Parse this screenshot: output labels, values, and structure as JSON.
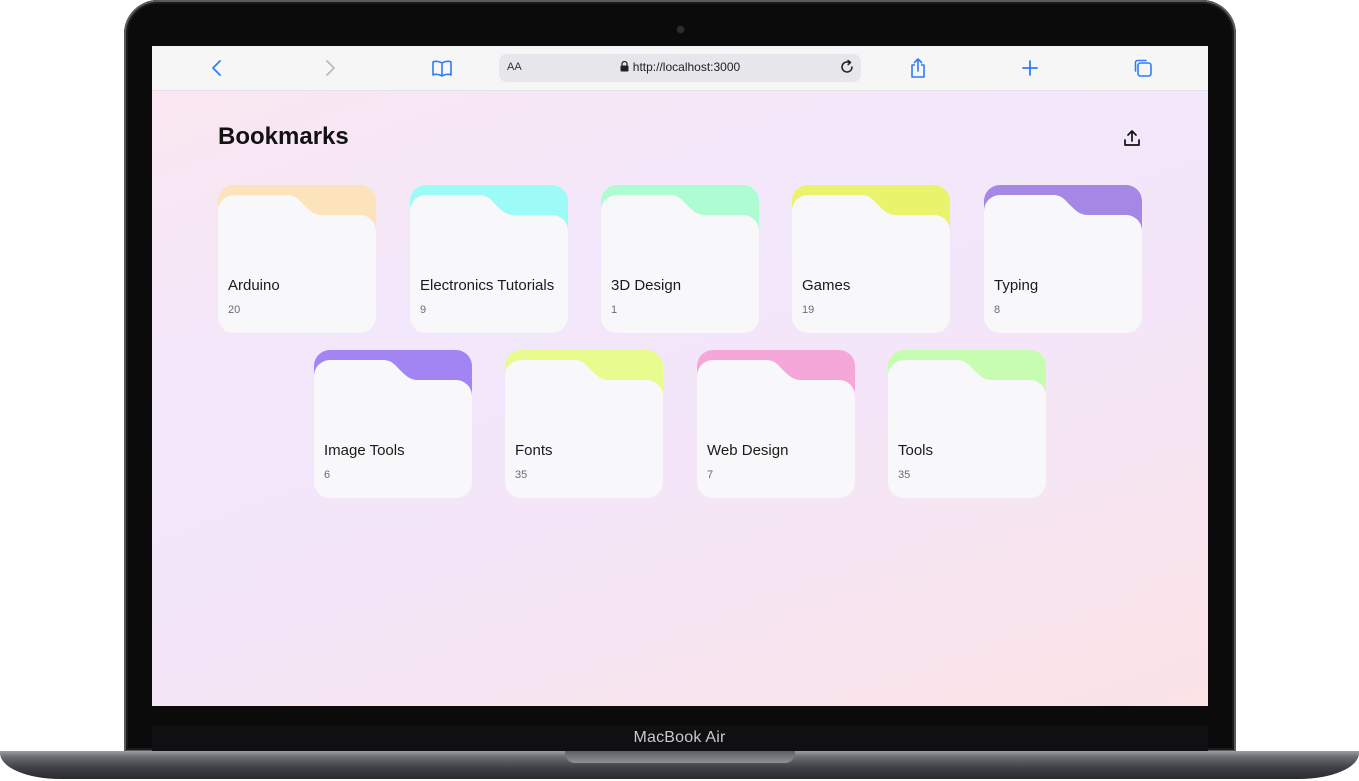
{
  "device": {
    "label": "MacBook Air"
  },
  "browser": {
    "text_size_label": "AA",
    "url": "http://localhost:3000"
  },
  "page": {
    "title": "Bookmarks"
  },
  "folders": [
    {
      "name": "Arduino",
      "count": "20",
      "color": "#fde3bc"
    },
    {
      "name": "Electronics Tutorials",
      "count": "9",
      "color": "#9cfaf7"
    },
    {
      "name": "3D Design",
      "count": "1",
      "color": "#aefcd2"
    },
    {
      "name": "Games",
      "count": "19",
      "color": "#e9f36c"
    },
    {
      "name": "Typing",
      "count": "8",
      "color": "#a588e5"
    },
    {
      "name": "Image Tools",
      "count": "6",
      "color": "#a384f3"
    },
    {
      "name": "Fonts",
      "count": "35",
      "color": "#e8fb8e"
    },
    {
      "name": "Web Design",
      "count": "7",
      "color": "#f6a7da"
    },
    {
      "name": "Tools",
      "count": "35",
      "color": "#c7fdb0"
    }
  ],
  "colors": {
    "accent": "#2f7cf6",
    "card": "#f8f8fa"
  }
}
